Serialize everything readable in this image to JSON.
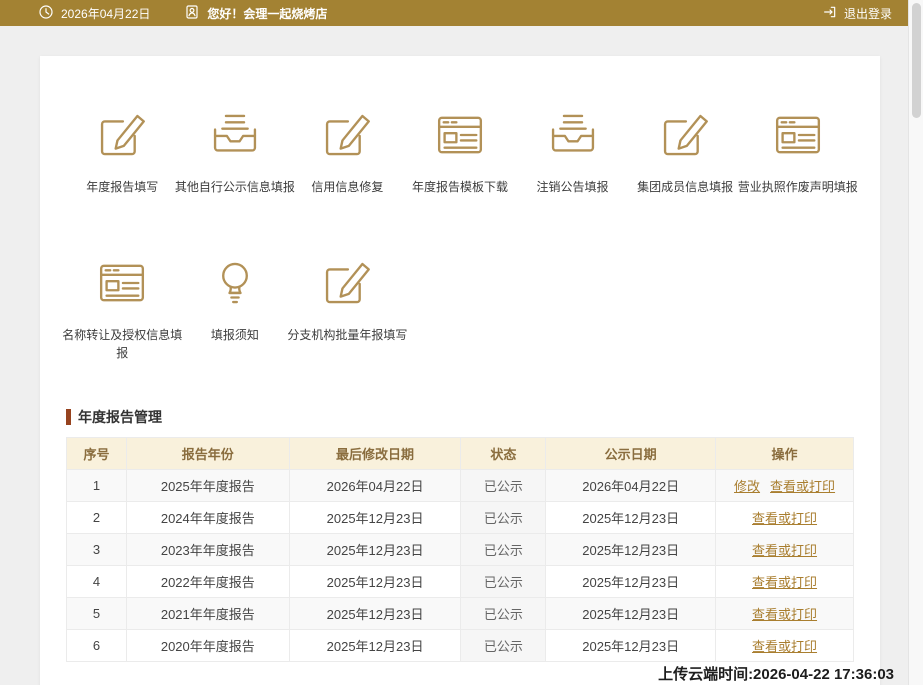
{
  "topbar": {
    "date": "2026年04月22日",
    "greeting": "您好！会理一起烧烤店",
    "logout_label": "退出登录"
  },
  "menu": {
    "items": [
      {
        "label": "年度报告填写",
        "icon": "edit-icon"
      },
      {
        "label": "其他自行公示信息填报",
        "icon": "inbox-icon"
      },
      {
        "label": "信用信息修复",
        "icon": "edit-icon"
      },
      {
        "label": "年度报告模板下载",
        "icon": "browser-icon"
      },
      {
        "label": "注销公告填报",
        "icon": "inbox-icon"
      },
      {
        "label": "集团成员信息填报",
        "icon": "edit-icon"
      },
      {
        "label": "营业执照作废声明填报",
        "icon": "browser-icon"
      },
      {
        "label": "名称转让及授权信息填报",
        "icon": "browser-icon"
      },
      {
        "label": "填报须知",
        "icon": "bulb-icon"
      },
      {
        "label": "分支机构批量年报填写",
        "icon": "edit-icon"
      }
    ]
  },
  "section": {
    "title": "年度报告管理"
  },
  "table": {
    "headers": [
      "序号",
      "报告年份",
      "最后修改日期",
      "状态",
      "公示日期",
      "操作"
    ],
    "rows": [
      {
        "no": "1",
        "year": "2025年年度报告",
        "modified": "2026年04月22日",
        "status": "已公示",
        "published": "2026年04月22日",
        "modify": "修改",
        "view": "查看或打印"
      },
      {
        "no": "2",
        "year": "2024年年度报告",
        "modified": "2025年12月23日",
        "status": "已公示",
        "published": "2025年12月23日",
        "view": "查看或打印"
      },
      {
        "no": "3",
        "year": "2023年年度报告",
        "modified": "2025年12月23日",
        "status": "已公示",
        "published": "2025年12月23日",
        "view": "查看或打印"
      },
      {
        "no": "4",
        "year": "2022年年度报告",
        "modified": "2025年12月23日",
        "status": "已公示",
        "published": "2025年12月23日",
        "view": "查看或打印"
      },
      {
        "no": "5",
        "year": "2021年年度报告",
        "modified": "2025年12月23日",
        "status": "已公示",
        "published": "2025年12月23日",
        "view": "查看或打印"
      },
      {
        "no": "6",
        "year": "2020年年度报告",
        "modified": "2025年12月23日",
        "status": "已公示",
        "published": "2025年12月23日",
        "view": "查看或打印"
      }
    ]
  },
  "footer": {
    "upload_time": "上传云端时间:2026-04-22 17:36:03"
  },
  "colors": {
    "accent": "#a38233",
    "icon": "#b29157",
    "link": "#a97e2f"
  }
}
